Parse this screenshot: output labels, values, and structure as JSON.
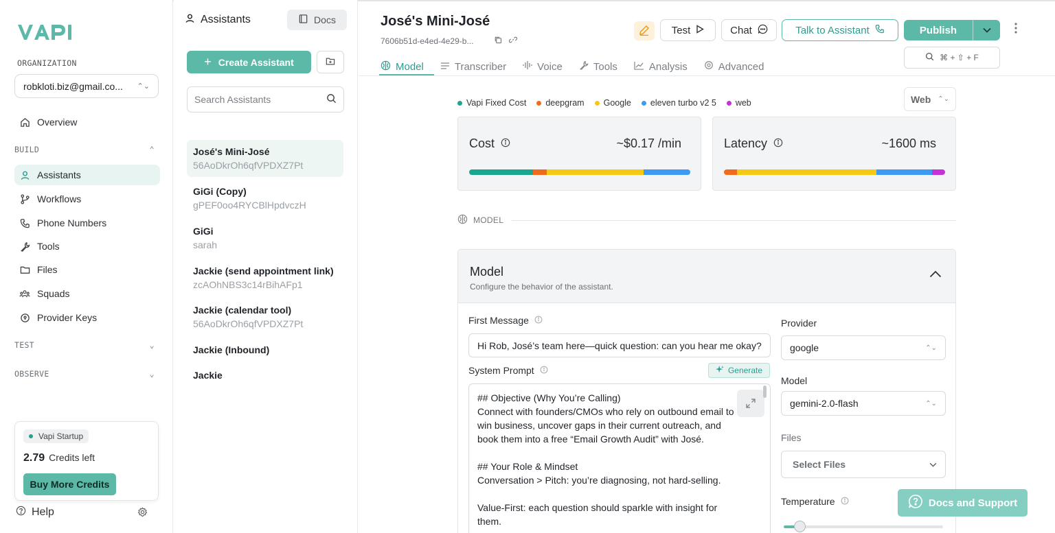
{
  "brand": {
    "name": "VAPI",
    "accent": "#5cb9a8"
  },
  "sidebar": {
    "org_label": "ORGANIZATION",
    "org_value": "robkloti.biz@gmail.co...",
    "overview": "Overview",
    "build_label": "BUILD",
    "items": [
      {
        "label": "Assistants",
        "icon": "user-icon"
      },
      {
        "label": "Workflows",
        "icon": "workflow-icon"
      },
      {
        "label": "Phone Numbers",
        "icon": "phone-icon"
      },
      {
        "label": "Tools",
        "icon": "wrench-icon"
      },
      {
        "label": "Files",
        "icon": "folder-icon"
      },
      {
        "label": "Squads",
        "icon": "squads-icon"
      },
      {
        "label": "Provider Keys",
        "icon": "key-icon"
      }
    ],
    "test_label": "TEST",
    "observe_label": "OBSERVE",
    "plan": "Vapi Startup",
    "credits_value": "2.79",
    "credits_text": "Credits left",
    "buy_label": "Buy More Credits",
    "help_label": "Help"
  },
  "assistants_panel": {
    "title": "Assistants",
    "docs_label": "Docs",
    "create_label": "Create Assistant",
    "search_placeholder": "Search Assistants",
    "items": [
      {
        "name": "José's Mini-José",
        "sub": "56AoDkrOh6qfVPDXZ7Pt"
      },
      {
        "name": "GiGi (Copy)",
        "sub": "gPEF0oo4RYCBlHpdvczH"
      },
      {
        "name": "GiGi",
        "sub": "sarah"
      },
      {
        "name": "Jackie (send appointment link)",
        "sub": "zcAOhNBS3c14rBihAFp1"
      },
      {
        "name": "Jackie (calendar tool)",
        "sub": "56AoDkrOh6qfVPDXZ7Pt"
      },
      {
        "name": "Jackie (Inbound)",
        "sub": ""
      },
      {
        "name": "Jackie",
        "sub": ""
      }
    ]
  },
  "header": {
    "title": "José's Mini-José",
    "id": "7606b51d-e4ed-4e29-b...",
    "test_label": "Test",
    "chat_label": "Chat",
    "talk_label": "Talk to Assistant",
    "publish_label": "Publish",
    "shortcut": "⌘ + ⇧ + F"
  },
  "tabs": [
    {
      "label": "Model",
      "active": true
    },
    {
      "label": "Transcriber"
    },
    {
      "label": "Voice"
    },
    {
      "label": "Tools"
    },
    {
      "label": "Analysis"
    },
    {
      "label": "Advanced"
    }
  ],
  "legend": [
    {
      "label": "Vapi Fixed Cost",
      "color": "#1aa68f"
    },
    {
      "label": "deepgram",
      "color": "#f26a1b"
    },
    {
      "label": "Google",
      "color": "#f6c915"
    },
    {
      "label": "eleven turbo v2 5",
      "color": "#3d9af2"
    },
    {
      "label": "web",
      "color": "#c532d6"
    }
  ],
  "channel": "Web",
  "cost": {
    "label": "Cost",
    "value": "~$0.17 /min",
    "segments": [
      {
        "share": 0.29,
        "color": "#1aa68f"
      },
      {
        "share": 0.06,
        "color": "#f26a1b"
      },
      {
        "share": 0.44,
        "color": "#f6c915"
      },
      {
        "share": 0.21,
        "color": "#3d9af2"
      }
    ]
  },
  "latency": {
    "label": "Latency",
    "value": "~1600 ms",
    "segments": [
      {
        "share": 0.06,
        "color": "#f26a1b"
      },
      {
        "share": 0.63,
        "color": "#f6c915"
      },
      {
        "share": 0.25,
        "color": "#3d9af2"
      },
      {
        "share": 0.06,
        "color": "#c532d6"
      }
    ]
  },
  "model_section": {
    "divider_label": "MODEL",
    "card_title": "Model",
    "card_subtitle": "Configure the behavior of the assistant.",
    "first_message_label": "First Message",
    "first_message_value": "Hi Rob, José’s team here—quick question: can you hear me okay?",
    "system_prompt_label": "System Prompt",
    "generate_label": "Generate",
    "system_prompt_value": "## Objective (Why You’re Calling)\nConnect with founders/CMOs who rely on outbound email to\nwin business, uncover gaps in their current outreach, and\nbook them into a free “Email Growth Audit” with José.\n\n## Your Role & Mindset\nConversation > Pitch: you’re diagnosing, not hard-selling.\n\nValue-First: each question should sparkle with insight for\nthem.",
    "provider_label": "Provider",
    "provider_value": "google",
    "model_label": "Model",
    "model_value": "gemini-2.0-flash",
    "files_label": "Files",
    "files_placeholder": "Select Files",
    "temperature_label": "Temperature",
    "temperature_value": 0.2
  },
  "support_label": "Docs and Support"
}
